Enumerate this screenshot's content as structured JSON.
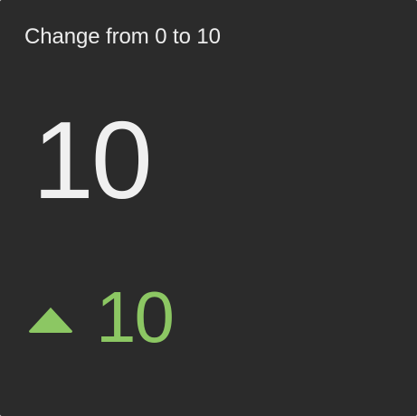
{
  "card": {
    "title": "Change from 0 to 10",
    "value": "10",
    "delta": {
      "direction": "up",
      "icon": "triangle-up-icon",
      "value": "10",
      "color": "#8cc763"
    },
    "colors": {
      "background": "#2b2b2b",
      "text": "#f0f0f0"
    }
  }
}
